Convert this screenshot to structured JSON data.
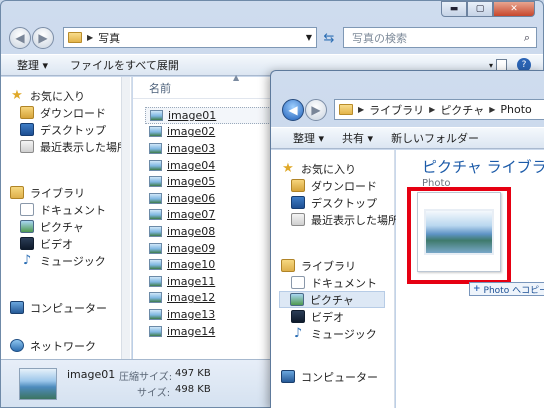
{
  "window_back": {
    "address": {
      "segments": [
        "写真"
      ]
    },
    "search_placeholder": "写真の検索",
    "toolbar": {
      "organize": "整理 ▾",
      "slideshow": "ファイルをすべて展開"
    },
    "column_header": "名前",
    "nav": {
      "favorites": "お気に入り",
      "downloads": "ダウンロード",
      "desktop": "デスクトップ",
      "recent": "最近表示した場所",
      "libraries": "ライブラリ",
      "documents": "ドキュメント",
      "pictures": "ピクチャ",
      "videos": "ビデオ",
      "music": "ミュージック",
      "computer": "コンピューター",
      "network": "ネットワーク"
    },
    "files": [
      "image01",
      "image02",
      "image03",
      "image04",
      "image05",
      "image06",
      "image07",
      "image08",
      "image09",
      "image10",
      "image11",
      "image12",
      "image13",
      "image14"
    ],
    "details": {
      "name": "image01",
      "compressed_label": "圧縮サイズ:",
      "compressed_value": "497 KB",
      "size_label": "サイズ:",
      "size_value": "498 KB"
    }
  },
  "window_front": {
    "address": {
      "segments": [
        "ライブラリ",
        "ピクチャ",
        "Photo"
      ]
    },
    "toolbar": {
      "organize": "整理 ▾",
      "share": "共有 ▾",
      "new_folder": "新しいフォルダー"
    },
    "nav": {
      "favorites": "お気に入り",
      "downloads": "ダウンロード",
      "desktop": "デスクトップ",
      "recent": "最近表示した場所",
      "libraries": "ライブラリ",
      "documents": "ドキュメント",
      "pictures": "ピクチャ",
      "videos": "ビデオ",
      "music": "ミュージック",
      "computer": "コンピューター"
    },
    "heading": "ピクチャ ライブラリ",
    "subheading": "Photo",
    "drag_tooltip": "Photo へコピー"
  },
  "colors": {
    "highlight_box": "#e60012",
    "heading": "#1b5aa8"
  }
}
